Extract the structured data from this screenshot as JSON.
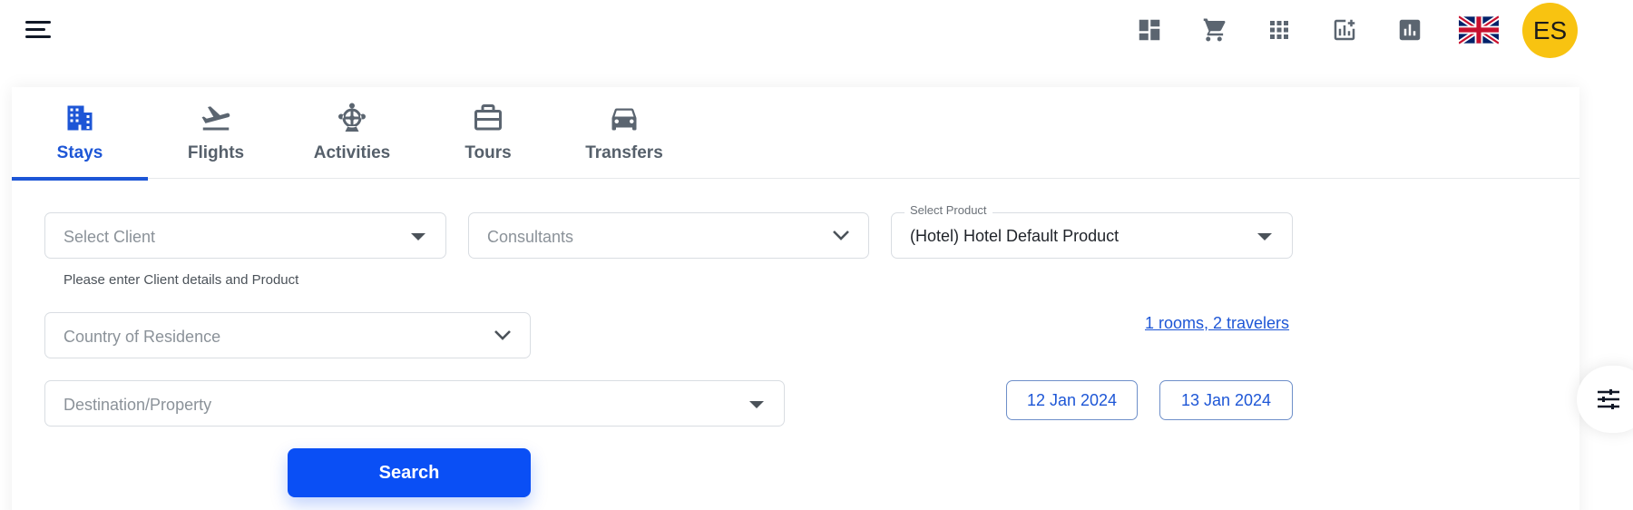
{
  "header": {
    "menu_icon": "menu-icon",
    "icons": [
      "dashboard-icon",
      "cart-icon",
      "apps-grid-icon",
      "add-chart-icon",
      "bar-chart-icon"
    ],
    "language_flag": "uk-flag-icon",
    "avatar_initials": "ES",
    "avatar_color": "#F8C311"
  },
  "tabs": [
    {
      "label": "Stays",
      "icon": "hotel-building-icon",
      "active": true
    },
    {
      "label": "Flights",
      "icon": "flight-takeoff-icon",
      "active": false
    },
    {
      "label": "Activities",
      "icon": "ferris-wheel-icon",
      "active": false
    },
    {
      "label": "Tours",
      "icon": "briefcase-icon",
      "active": false
    },
    {
      "label": "Transfers",
      "icon": "car-icon",
      "active": false
    }
  ],
  "form": {
    "select_client": {
      "placeholder": "Select Client"
    },
    "consultants": {
      "placeholder": "Consultants"
    },
    "select_product": {
      "label": "Select Product",
      "value": "(Hotel) Hotel Default Product"
    },
    "client_helper": "Please enter Client details and Product",
    "country_of_residence": {
      "placeholder": "Country of Residence"
    },
    "rooms_travelers": "1 rooms, 2 travelers",
    "destination": {
      "placeholder": "Destination/Property"
    },
    "check_in": "12 Jan 2024",
    "check_out": "13 Jan 2024",
    "search_label": "Search"
  },
  "filters_icon": "tune-sliders-icon",
  "colors": {
    "accent": "#1D56D6",
    "primary_button": "#0A4FF5",
    "icon_gray": "#5B6570"
  }
}
